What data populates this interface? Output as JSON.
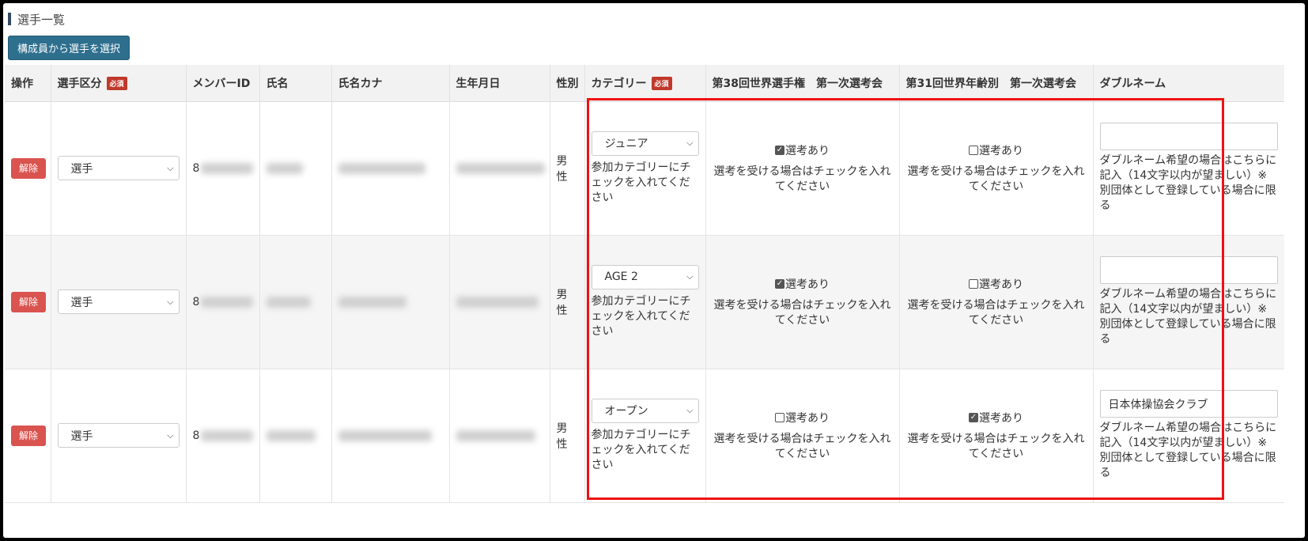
{
  "section_title": "選手一覧",
  "select_button": "構成員から選手を選択",
  "required_badge": "必須",
  "headers": {
    "action": "操作",
    "player_type": "選手区分",
    "member_id": "メンバーID",
    "name": "氏名",
    "name_kana": "氏名カナ",
    "birthdate": "生年月日",
    "gender": "性別",
    "category": "カテゴリー",
    "worlds38": "第38回世界選手権　第一次選考会",
    "worlds31": "第31回世界年齢別　第一次選考会",
    "double_name": "ダブルネーム"
  },
  "labels": {
    "release": "解除",
    "category_help": "参加カテゴリーにチェックを入れてください",
    "selection_label": "選考あり",
    "selection_help": "選考を受ける場合はチェックを入れてください",
    "double_help": "ダブルネーム希望の場合はこちらに記入（14文字以内が望ましい）※別団体として登録している場合に限る"
  },
  "rows": [
    {
      "player_type": "選手",
      "member_id_prefix": "8",
      "gender": "男性",
      "category": "ジュニア",
      "worlds38_checked": true,
      "worlds31_checked": false,
      "double_name": ""
    },
    {
      "player_type": "選手",
      "member_id_prefix": "8",
      "gender": "男性",
      "category": "AGE 2",
      "worlds38_checked": true,
      "worlds31_checked": false,
      "double_name": ""
    },
    {
      "player_type": "選手",
      "member_id_prefix": "8",
      "gender": "男性",
      "category": "オープン",
      "worlds38_checked": false,
      "worlds31_checked": true,
      "double_name": "日本体操協会クラブ"
    }
  ],
  "colors": {
    "select_button": "#2e6f8e",
    "release_button": "#d9534f",
    "required_badge": "#c0392b",
    "highlight_border": "#ee1111"
  }
}
